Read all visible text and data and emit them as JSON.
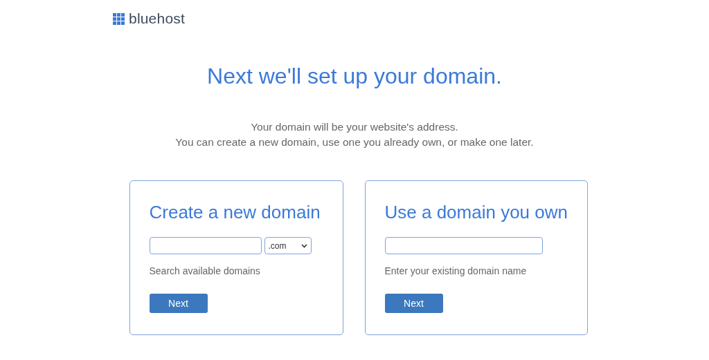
{
  "logo": {
    "text": "bluehost"
  },
  "heading": "Next we'll set up your domain.",
  "intro": [
    "Your domain will be your website's address.",
    "You can create a new domain, use one you already own, or make one later."
  ],
  "cards": [
    {
      "kind": "create",
      "title": "Create a new domain",
      "tld": ".com",
      "hint": "Search available domains",
      "button": "Next"
    },
    {
      "kind": "existing",
      "title": "Use a domain you own",
      "hint": "Enter your existing domain name",
      "button": "Next"
    }
  ]
}
